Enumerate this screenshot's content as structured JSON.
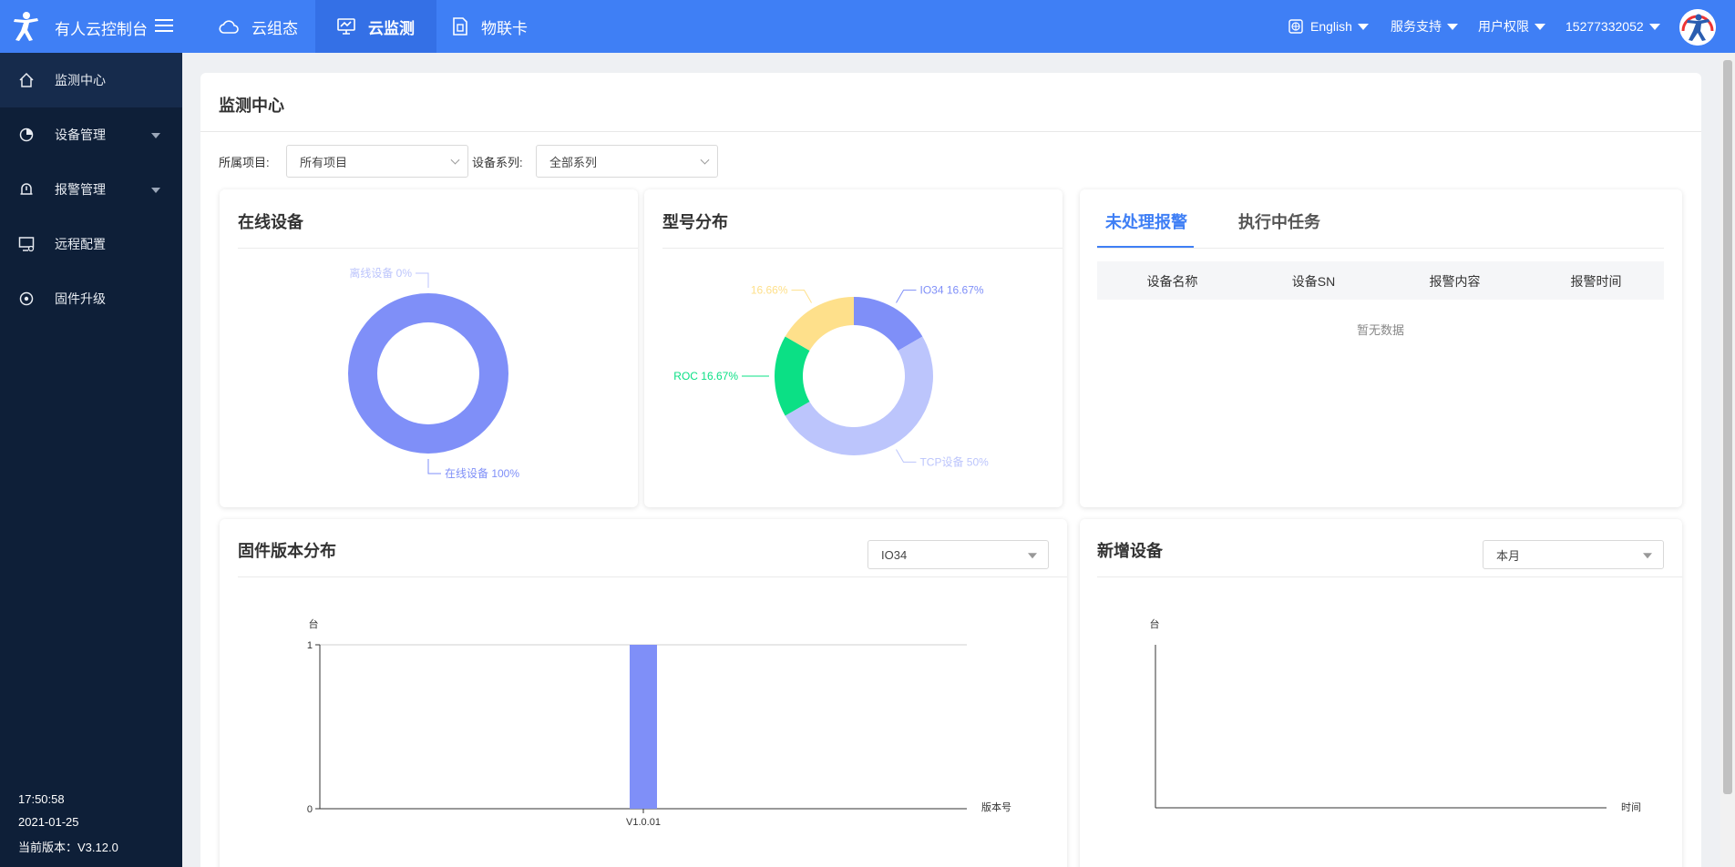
{
  "app": {
    "title": "有人云控制台"
  },
  "nav": {
    "tabs": [
      {
        "label": "云组态",
        "icon": "cloud-icon"
      },
      {
        "label": "云监测",
        "icon": "monitor-icon"
      },
      {
        "label": "物联卡",
        "icon": "sim-card-icon"
      }
    ],
    "active": 1
  },
  "topright": {
    "language": "English",
    "service": "服务支持",
    "permissions": "用户权限",
    "account": "15277332052"
  },
  "sidebar": {
    "items": [
      {
        "label": "监测中心",
        "icon": "home-icon"
      },
      {
        "label": "设备管理",
        "icon": "device-icon"
      },
      {
        "label": "报警管理",
        "icon": "alarm-bell-icon"
      },
      {
        "label": "远程配置",
        "icon": "remote-config-icon"
      },
      {
        "label": "固件升级",
        "icon": "firmware-icon"
      }
    ],
    "footer": {
      "time": "17:50:58",
      "date": "2021-01-25",
      "version": "当前版本：V3.12.0"
    }
  },
  "page": {
    "title": "监测中心"
  },
  "filters": {
    "project_label": "所属项目:",
    "project_value": "所有项目",
    "series_label": "设备系列:",
    "series_value": "全部系列"
  },
  "cards": {
    "online": {
      "title": "在线设备"
    },
    "model": {
      "title": "型号分布"
    },
    "alarm": {
      "tabs": [
        "未处理报警",
        "执行中任务"
      ],
      "columns": [
        "设备名称",
        "设备SN",
        "报警内容",
        "报警时间"
      ],
      "empty": "暂无数据"
    },
    "firmware": {
      "title": "固件版本分布",
      "select": "IO34"
    },
    "newdev": {
      "title": "新增设备",
      "select": "本月"
    }
  },
  "colors": {
    "accent": "#3f7ff5",
    "sidebar": "#0e1f38",
    "primary_series": "#7f8ff8"
  },
  "chart_data": [
    {
      "type": "pie",
      "title": "在线设备",
      "slices": [
        {
          "label": "在线设备",
          "value": 100,
          "text": "在线设备  100%",
          "color": "#7f8ff8"
        },
        {
          "label": "离线设备",
          "value": 0,
          "text": "离线设备  0%",
          "color": "#bcc5fc"
        }
      ]
    },
    {
      "type": "pie",
      "title": "型号分布",
      "slices": [
        {
          "label": "IO34",
          "value": 16.67,
          "text": "IO34  16.67%",
          "color": "#7f8ff8"
        },
        {
          "label": "TCP设备",
          "value": 50,
          "text": "TCP设备  50%",
          "color": "#bcc5fc"
        },
        {
          "label": "ROC",
          "value": 16.67,
          "text": "ROC  16.67%",
          "color": "#0be085"
        },
        {
          "label": "",
          "value": 16.66,
          "text": "16.66%",
          "color": "#fee08b"
        }
      ]
    },
    {
      "type": "bar",
      "title": "固件版本分布",
      "categories": [
        "V1.0.01"
      ],
      "values": [
        1
      ],
      "ylabel": "台",
      "xlabel": "版本号",
      "ylim": [
        0,
        1
      ],
      "yticks": [
        "0",
        "1"
      ],
      "color": "#7f8ff8"
    },
    {
      "type": "line",
      "title": "新增设备",
      "categories": [],
      "values": [],
      "ylabel": "台",
      "xlabel": "时间"
    }
  ]
}
